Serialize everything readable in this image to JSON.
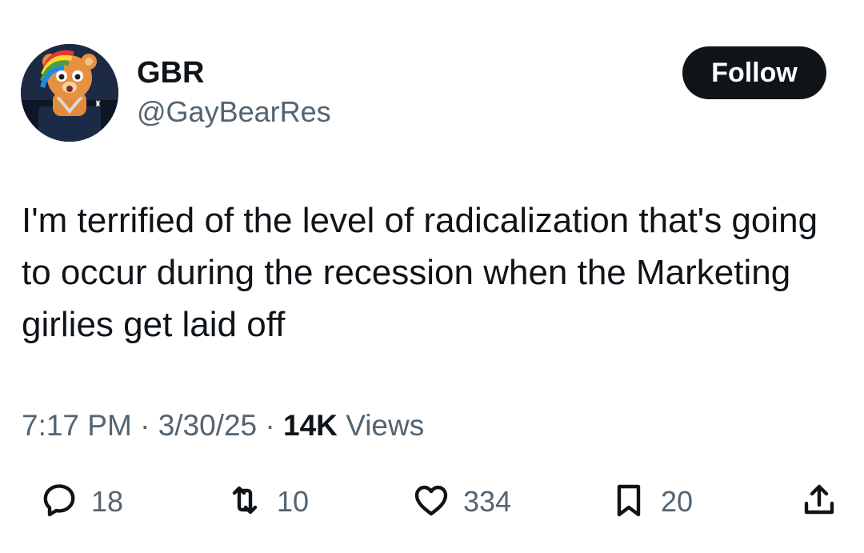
{
  "tweet": {
    "author": {
      "display_name": "GBR",
      "handle": "@GayBearRes"
    },
    "follow_label": "Follow",
    "text": "I'm terrified of the level of radicalization that's going to occur during the recession when the Marketing girlies get laid off",
    "time": "7:17 PM",
    "separator": "·",
    "date": "3/30/25",
    "views_count": "14K",
    "views_label": "Views",
    "stats": {
      "replies": "18",
      "retweets": "10",
      "likes": "334",
      "bookmarks": "20"
    }
  },
  "icons": {
    "reply": "reply-icon",
    "retweet": "retweet-icon",
    "like": "heart-icon",
    "bookmark": "bookmark-icon",
    "share": "share-icon"
  },
  "colors": {
    "text_primary": "#0f1419",
    "text_secondary": "#536471",
    "button_bg": "#0f1419",
    "button_text": "#ffffff"
  }
}
